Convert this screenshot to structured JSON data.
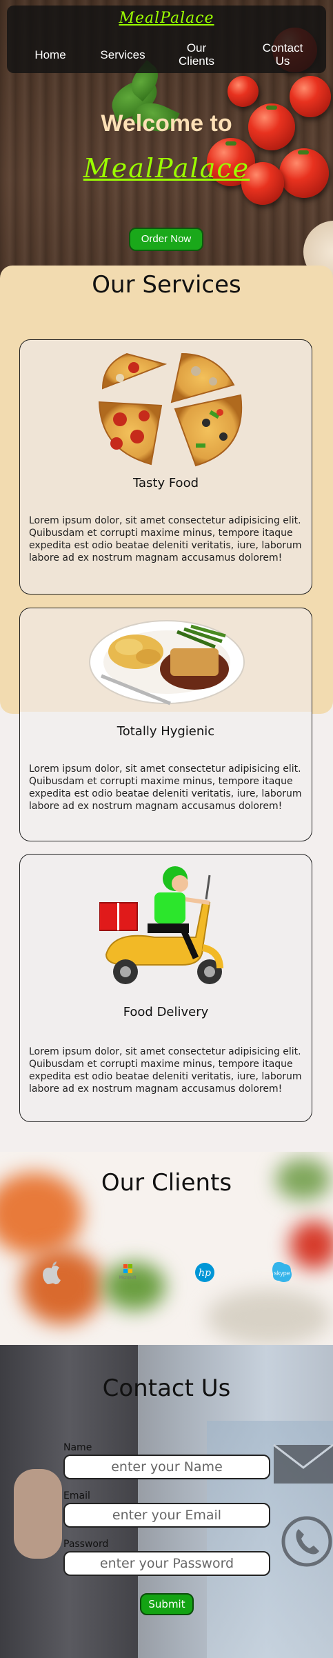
{
  "header": {
    "brand": "MealPalace",
    "nav": [
      "Home",
      "Services",
      "Our Clients",
      "Contact Us"
    ]
  },
  "hero": {
    "welcome": "Welcome to",
    "brand": "MealPalace",
    "cta": "Order Now"
  },
  "services": {
    "title": "Our Services",
    "cards": [
      {
        "title": "Tasty Food",
        "text": "Lorem ipsum dolor, sit amet consectetur adipisicing elit. Quibusdam et corrupti maxime minus, tempore itaque expedita est odio beatae deleniti veritatis, iure, laborum labore ad ex nostrum magnam accusamus dolorem!"
      },
      {
        "title": "Totally Hygienic",
        "text": "Lorem ipsum dolor, sit amet consectetur adipisicing elit. Quibusdam et corrupti maxime minus, tempore itaque expedita est odio beatae deleniti veritatis, iure, laborum labore ad ex nostrum magnam accusamus dolorem!"
      },
      {
        "title": "Food Delivery",
        "text": "Lorem ipsum dolor, sit amet consectetur adipisicing elit. Quibusdam et corrupti maxime minus, tempore itaque expedita est odio beatae deleniti veritatis, iure, laborum labore ad ex nostrum magnam accusamus dolorem!"
      }
    ]
  },
  "clients": {
    "title": "Our Clients",
    "logos": [
      "apple-logo",
      "microsoft-logo",
      "hp-logo",
      "skype-logo"
    ],
    "microsoft_text": "Microsoft",
    "hp_text": "hp",
    "skype_text": "skype"
  },
  "contact": {
    "title": "Contact Us",
    "name_label": "Name",
    "name_placeholder": "enter your Name",
    "email_label": "Email",
    "email_placeholder": "enter your Email",
    "password_label": "Password",
    "password_placeholder": "enter your Password",
    "submit": "Submit"
  }
}
